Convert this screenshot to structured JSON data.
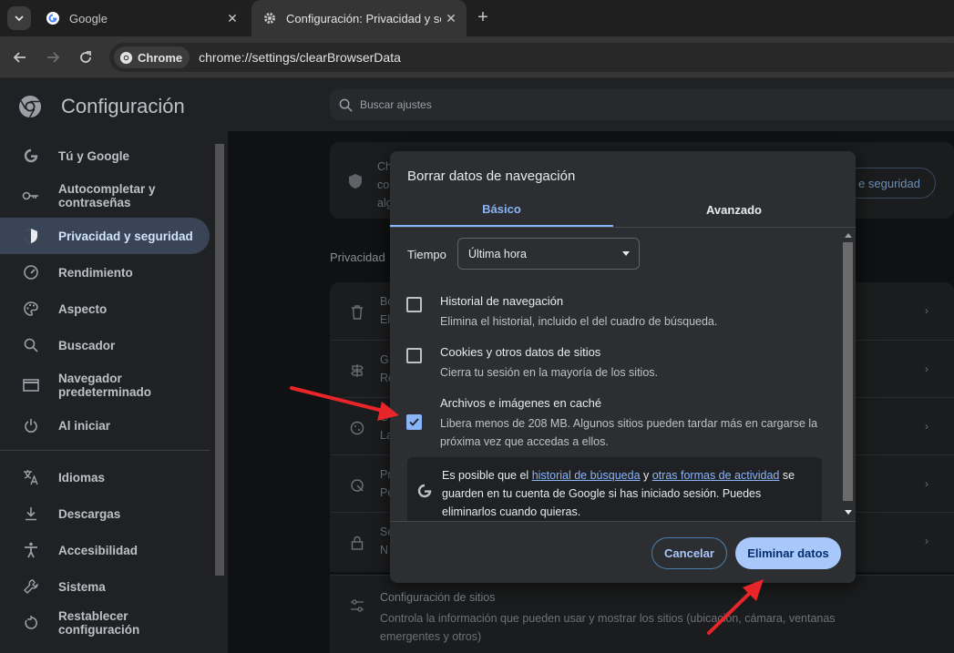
{
  "browser": {
    "tabs": [
      {
        "title": "Google",
        "active": false
      },
      {
        "title": "Configuración: Privacidad y seg",
        "active": true
      }
    ],
    "chip_label": "Chrome",
    "url": "chrome://settings/clearBrowserData"
  },
  "settings": {
    "title": "Configuración",
    "search_placeholder": "Buscar ajustes",
    "sidebar": [
      {
        "label": "Tú y Google",
        "icon": "google-g-icon",
        "selected": false
      },
      {
        "label": "Autocompletar y contraseñas",
        "icon": "key-icon",
        "selected": false
      },
      {
        "label": "Privacidad y seguridad",
        "icon": "shield-icon",
        "selected": true
      },
      {
        "label": "Rendimiento",
        "icon": "speedometer-icon",
        "selected": false
      },
      {
        "label": "Aspecto",
        "icon": "palette-icon",
        "selected": false
      },
      {
        "label": "Buscador",
        "icon": "search-icon",
        "selected": false
      },
      {
        "label": "Navegador predeterminado",
        "icon": "browser-window-icon",
        "selected": false
      },
      {
        "label": "Al iniciar",
        "icon": "power-icon",
        "selected": false
      },
      {
        "label": "Idiomas",
        "icon": "translate-icon",
        "selected": false
      },
      {
        "label": "Descargas",
        "icon": "download-icon",
        "selected": false
      },
      {
        "label": "Accesibilidad",
        "icon": "accessibility-icon",
        "selected": false
      },
      {
        "label": "Sistema",
        "icon": "wrench-icon",
        "selected": false
      },
      {
        "label": "Restablecer configuración",
        "icon": "restore-icon",
        "selected": false
      }
    ],
    "background": {
      "card_text_lines": [
        "Ch",
        "co",
        "alg"
      ],
      "card_button": "e seguridad",
      "section_heading": "Privacidad",
      "rows": [
        {
          "title": "Bo",
          "desc": "El"
        },
        {
          "title": "G",
          "desc": "Re"
        },
        {
          "title": "C",
          "desc": "La"
        },
        {
          "title": "Pr",
          "desc": "Pe"
        },
        {
          "title": "Se",
          "desc": "N"
        }
      ],
      "site_settings_title": "Configuración de sitios",
      "site_settings_desc": "Controla la información que pueden usar y mostrar los sitios (ubicación, cámara, ventanas emergentes y otros)"
    }
  },
  "dialog": {
    "title": "Borrar datos de navegación",
    "tabs": {
      "basic": "Básico",
      "advanced": "Avanzado"
    },
    "time_label": "Tiempo",
    "time_value": "Última hora",
    "options": [
      {
        "title": "Historial de navegación",
        "desc": "Elimina el historial, incluido el del cuadro de búsqueda.",
        "checked": false
      },
      {
        "title": "Cookies y otros datos de sitios",
        "desc": "Cierra tu sesión en la mayoría de los sitios.",
        "checked": false
      },
      {
        "title": "Archivos e imágenes en caché",
        "desc": "Libera menos de 208 MB. Algunos sitios pueden tardar más en cargarse la próxima vez que accedas a ellos.",
        "checked": true
      }
    ],
    "info": {
      "prefix": "Es posible que el ",
      "link1": "historial de búsqueda",
      "middle": " y ",
      "link2": "otras formas de actividad",
      "suffix": " se guarden en tu cuenta de Google si has iniciado sesión. Puedes eliminarlos cuando quieras."
    },
    "cancel_label": "Cancelar",
    "delete_label": "Eliminar datos"
  },
  "colors": {
    "accent": "#8ab4f8",
    "primary_button": "#a8c7fa",
    "annotation_arrow": "#e8262a"
  }
}
